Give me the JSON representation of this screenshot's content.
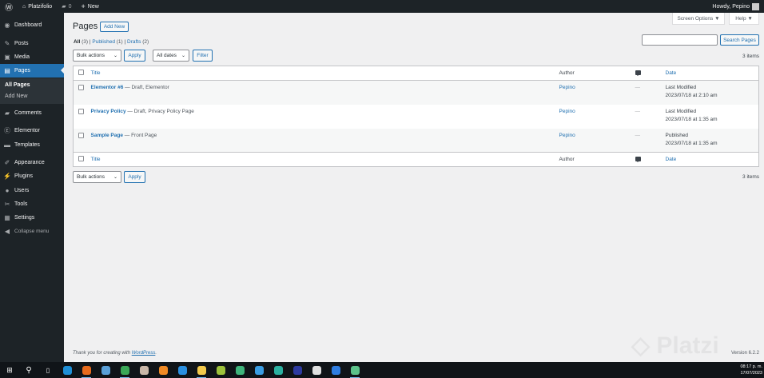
{
  "adminbar": {
    "site": "Platzifolio",
    "comments": "0",
    "new": "New",
    "howdy": "Howdy, Pepino"
  },
  "sidebar": {
    "items": [
      {
        "label": "Dashboard",
        "icon": "dashboard-icon",
        "glyph": "◉"
      },
      {
        "label": "Posts",
        "icon": "pin-icon",
        "glyph": "✎"
      },
      {
        "label": "Media",
        "icon": "media-icon",
        "glyph": "▣"
      },
      {
        "label": "Pages",
        "icon": "pages-icon",
        "glyph": "▤"
      },
      {
        "label": "Comments",
        "icon": "comment-icon",
        "glyph": "▰"
      },
      {
        "label": "Elementor",
        "icon": "elementor-icon",
        "glyph": "Ⓔ"
      },
      {
        "label": "Templates",
        "icon": "folder-icon",
        "glyph": "▬"
      },
      {
        "label": "Appearance",
        "icon": "brush-icon",
        "glyph": "✐"
      },
      {
        "label": "Plugins",
        "icon": "plugin-icon",
        "glyph": "⚡"
      },
      {
        "label": "Users",
        "icon": "user-icon",
        "glyph": "●"
      },
      {
        "label": "Tools",
        "icon": "wrench-icon",
        "glyph": "✂"
      },
      {
        "label": "Settings",
        "icon": "settings-icon",
        "glyph": "▦"
      }
    ],
    "submenu": [
      "All Pages",
      "Add New"
    ],
    "collapse": "Collapse menu"
  },
  "header": {
    "title": "Pages",
    "add_new": "Add New",
    "screen_options": "Screen Options ▼",
    "help": "Help ▼"
  },
  "views": {
    "all": "All",
    "all_count": "(3)",
    "published": "Published",
    "published_count": "(1)",
    "drafts": "Drafts",
    "drafts_count": "(2)"
  },
  "search": {
    "value": "",
    "button": "Search Pages"
  },
  "filters": {
    "bulk": "Bulk actions",
    "apply": "Apply",
    "dates": "All dates",
    "filter": "Filter"
  },
  "count": "3 items",
  "table": {
    "columns": {
      "title": "Title",
      "author": "Author",
      "date": "Date"
    },
    "rows": [
      {
        "title": "Elementor #6",
        "state": " — Draft, Elementor",
        "author": "Pepino",
        "comments": "—",
        "status": "Last Modified",
        "date": "2023/07/18 at 2:10 am"
      },
      {
        "title": "Privacy Policy",
        "state": " — Draft, Privacy Policy Page",
        "author": "Pepino",
        "comments": "—",
        "status": "Last Modified",
        "date": "2023/07/18 at 1:35 am"
      },
      {
        "title": "Sample Page",
        "state": " — Front Page",
        "author": "Pepino",
        "comments": "—",
        "status": "Published",
        "date": "2023/07/18 at 1:35 am"
      }
    ]
  },
  "footer": {
    "thanks": "Thank you for creating with ",
    "wp": "WordPress",
    "thanks_end": ".",
    "version": "Version 6.2.2"
  },
  "taskbar": {
    "time": "08:17 p. m.",
    "date": "17/07/2023",
    "apps": [
      {
        "icon": "edge-icon",
        "color": "#1f8fd6"
      },
      {
        "icon": "firefox-icon",
        "color": "#e66a1c",
        "run": true
      },
      {
        "icon": "app-icon",
        "color": "#5aa0d8"
      },
      {
        "icon": "chrome-icon",
        "color": "#3aa757",
        "run": true
      },
      {
        "icon": "app-icon",
        "color": "#c9b7a8"
      },
      {
        "icon": "sublime-icon",
        "color": "#f08a24"
      },
      {
        "icon": "vscode-icon",
        "color": "#2a8fe0"
      },
      {
        "icon": "file-explorer-icon",
        "color": "#f3c94b",
        "run": true
      },
      {
        "icon": "app-icon",
        "color": "#9dc23b"
      },
      {
        "icon": "app-icon",
        "color": "#3fb57c"
      },
      {
        "icon": "app-icon",
        "color": "#3a9de3"
      },
      {
        "icon": "app-icon",
        "color": "#2bb0a0"
      },
      {
        "icon": "app-icon",
        "color": "#2d3aa0"
      },
      {
        "icon": "slack-icon",
        "color": "#e0e0e0"
      },
      {
        "icon": "app-icon",
        "color": "#2f7de1"
      },
      {
        "icon": "app-icon",
        "color": "#5cc28a",
        "run": true
      }
    ]
  },
  "watermark": "Platzi"
}
